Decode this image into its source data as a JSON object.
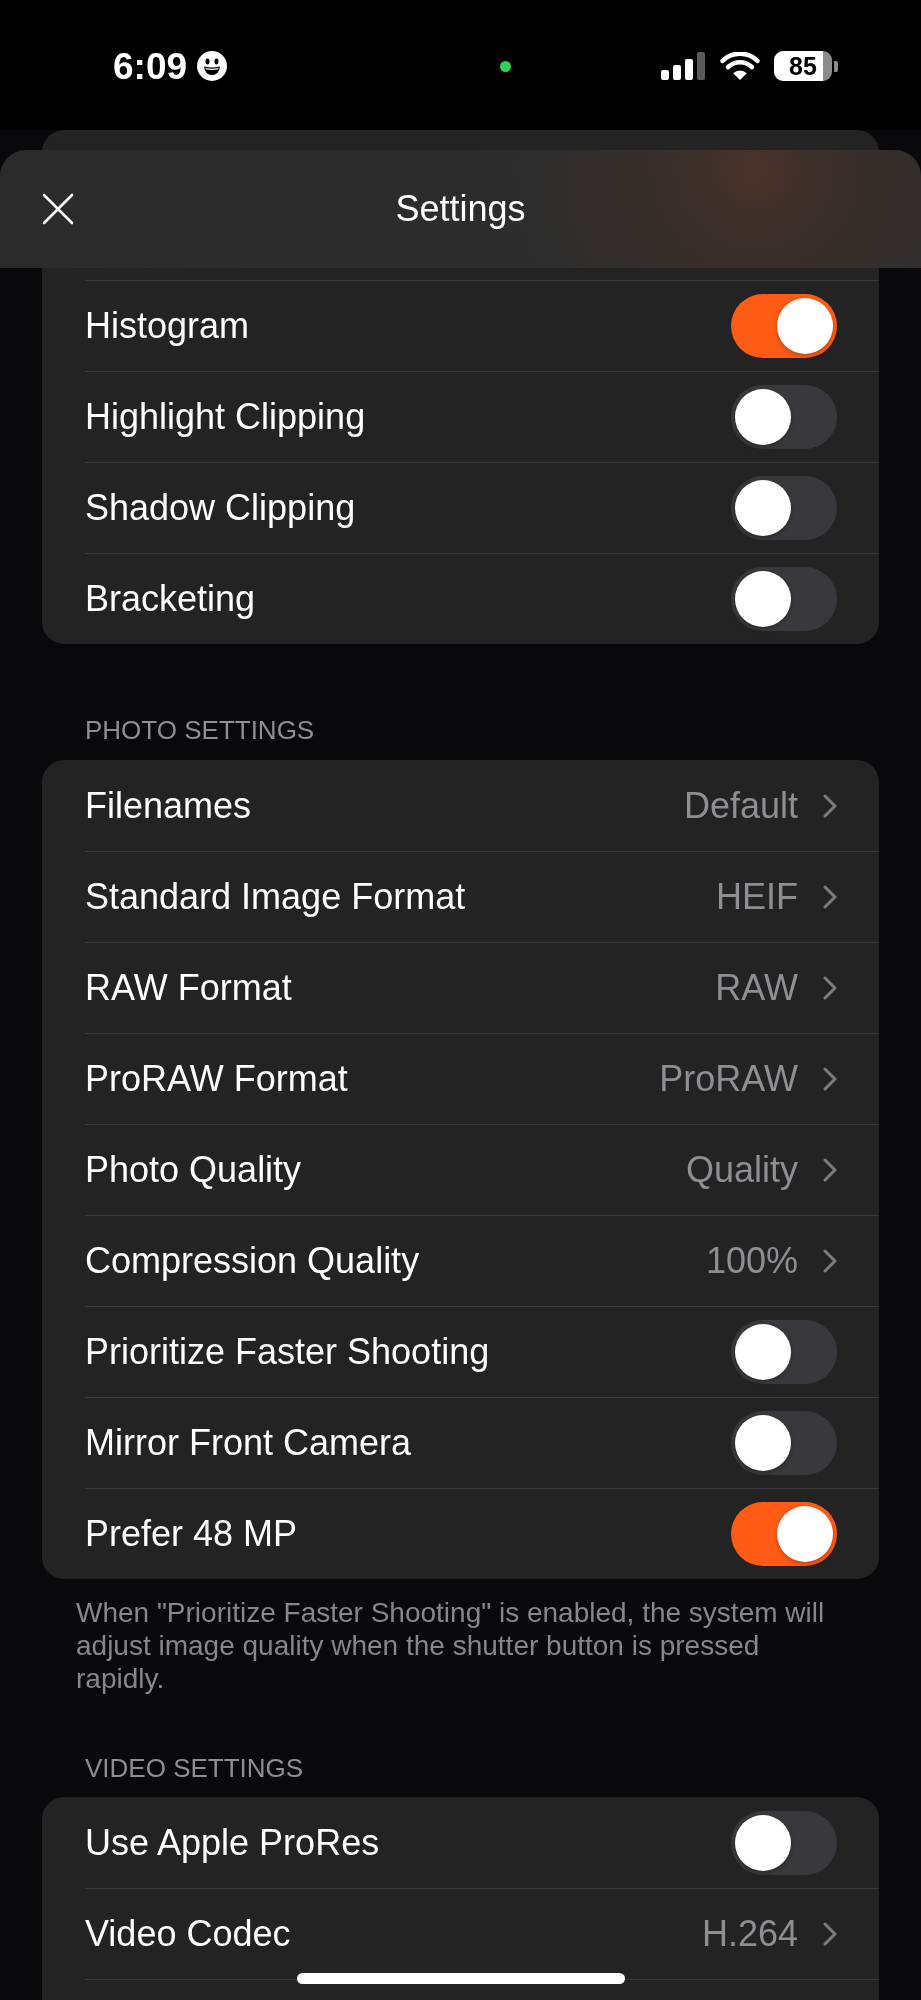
{
  "status_bar": {
    "time": "6:09",
    "battery": "85"
  },
  "header": {
    "title": "Settings"
  },
  "sections": [
    {
      "rows": [
        {
          "kind": "toggle",
          "label": "Histogram",
          "on": true
        },
        {
          "kind": "toggle",
          "label": "Highlight Clipping",
          "on": false
        },
        {
          "kind": "toggle",
          "label": "Shadow Clipping",
          "on": false
        },
        {
          "kind": "toggle",
          "label": "Bracketing",
          "on": false
        }
      ]
    },
    {
      "title": "PHOTO SETTINGS",
      "rows": [
        {
          "kind": "link",
          "label": "Filenames",
          "value": "Default"
        },
        {
          "kind": "link",
          "label": "Standard Image Format",
          "value": "HEIF"
        },
        {
          "kind": "link",
          "label": "RAW Format",
          "value": "RAW"
        },
        {
          "kind": "link",
          "label": "ProRAW Format",
          "value": "ProRAW"
        },
        {
          "kind": "link",
          "label": "Photo Quality",
          "value": "Quality"
        },
        {
          "kind": "link",
          "label": "Compression Quality",
          "value": "100%"
        },
        {
          "kind": "toggle",
          "label": "Prioritize Faster Shooting",
          "on": false
        },
        {
          "kind": "toggle",
          "label": "Mirror Front Camera",
          "on": false
        },
        {
          "kind": "toggle",
          "label": "Prefer 48 MP",
          "on": true
        }
      ],
      "footer": "When \"Prioritize Faster Shooting\" is enabled, the system will adjust image quality when the shutter button is pressed rapidly."
    },
    {
      "title": "VIDEO SETTINGS",
      "rows": [
        {
          "kind": "toggle",
          "label": "Use Apple ProRes",
          "on": false
        },
        {
          "kind": "link",
          "label": "Video Codec",
          "value": "H.264"
        }
      ]
    }
  ]
}
